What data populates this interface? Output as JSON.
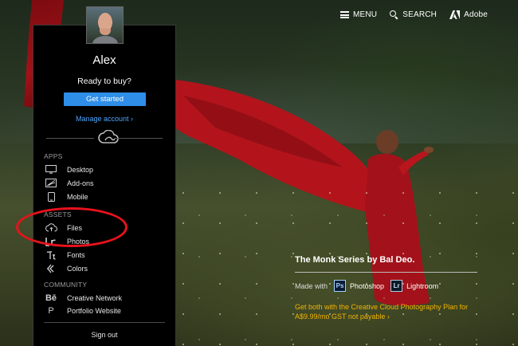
{
  "topnav": {
    "menu_label": "MENU",
    "search_label": "SEARCH",
    "brand_label": "Adobe"
  },
  "account": {
    "user_name": "Alex",
    "prompt": "Ready to buy?",
    "cta_label": "Get started",
    "manage_label": "Manage account ›",
    "signout_label": "Sign out"
  },
  "sections": {
    "apps": {
      "heading": "APPS",
      "items": [
        {
          "label": "Desktop",
          "icon": "monitor-icon"
        },
        {
          "label": "Add-ons",
          "icon": "add-ons-icon"
        },
        {
          "label": "Mobile",
          "icon": "mobile-icon"
        }
      ]
    },
    "assets": {
      "heading": "ASSETS",
      "items": [
        {
          "label": "Files",
          "icon": "cloud-upload-icon"
        },
        {
          "label": "Photos",
          "icon": "photos-icon"
        },
        {
          "label": "Fonts",
          "icon": "fonts-icon"
        },
        {
          "label": "Colors",
          "icon": "colors-icon"
        }
      ]
    },
    "community": {
      "heading": "COMMUNITY",
      "items": [
        {
          "label": "Creative Network",
          "icon": "behance-icon",
          "glyph": "Bē"
        },
        {
          "label": "Portfolio Website",
          "icon": "portfolio-icon",
          "glyph": "P"
        }
      ]
    }
  },
  "caption": {
    "title": "The Monk Series by Bal Deo.",
    "made_with": "Made with",
    "app1_badge": "Ps",
    "app1_name": "Photoshop",
    "app2_badge": "Lr",
    "app2_name": "Lightroom",
    "promo": "Get both with the Creative Cloud Photography Plan for A$9.99/mo GST not payable ›"
  },
  "colors": {
    "accent_blue": "#2e8ee8",
    "link_blue": "#4da6ff",
    "promo_gold": "#f4b400",
    "annotation_red": "#e8121c",
    "panel_bg": "#000000"
  }
}
